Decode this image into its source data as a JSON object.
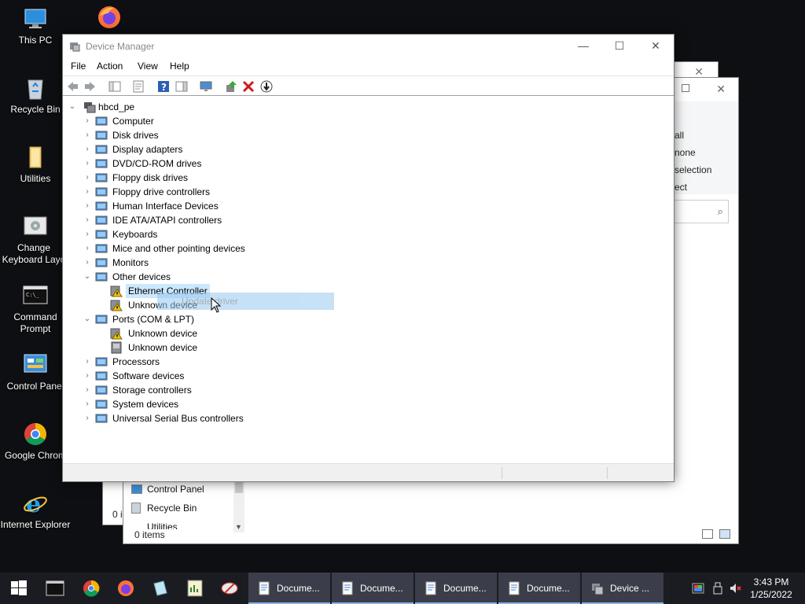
{
  "desktop": {
    "icons": [
      {
        "label": "This PC",
        "icon": "this-pc-icon"
      },
      {
        "label": "Recycle Bin",
        "icon": "recycle-bin-icon"
      },
      {
        "label": "Utilities",
        "icon": "folder-icon"
      },
      {
        "label": "Change Keyboard Layo",
        "icon": "keyboard-settings-icon"
      },
      {
        "label": "Command Prompt",
        "icon": "command-prompt-icon"
      },
      {
        "label": "Control Panel",
        "icon": "control-panel-icon"
      },
      {
        "label": "Google Chrom",
        "icon": "chrome-icon"
      },
      {
        "label": "Internet Explorer",
        "icon": "internet-explorer-icon"
      }
    ]
  },
  "background_window": {
    "ribbon_items": [
      "all",
      "none",
      "selection",
      "ect"
    ],
    "sidebar_items": [
      "Control Panel",
      "Recycle Bin",
      "Utilities"
    ],
    "status": "0 items",
    "left_status": "0 i"
  },
  "device_manager": {
    "title": "Device Manager",
    "menu": [
      "File",
      "Action",
      "View",
      "Help"
    ],
    "root": "hbcd_pe",
    "categories": [
      {
        "label": "Computer",
        "icon": "computer-icon",
        "expanded": false
      },
      {
        "label": "Disk drives",
        "icon": "disk-drive-icon",
        "expanded": false
      },
      {
        "label": "Display adapters",
        "icon": "display-adapter-icon",
        "expanded": false
      },
      {
        "label": "DVD/CD-ROM drives",
        "icon": "dvd-drive-icon",
        "expanded": false
      },
      {
        "label": "Floppy disk drives",
        "icon": "floppy-drive-icon",
        "expanded": false
      },
      {
        "label": "Floppy drive controllers",
        "icon": "controller-icon",
        "expanded": false
      },
      {
        "label": "Human Interface Devices",
        "icon": "hid-icon",
        "expanded": false
      },
      {
        "label": "IDE ATA/ATAPI controllers",
        "icon": "controller-icon",
        "expanded": false
      },
      {
        "label": "Keyboards",
        "icon": "keyboard-icon",
        "expanded": false
      },
      {
        "label": "Mice and other pointing devices",
        "icon": "mouse-icon",
        "expanded": false
      },
      {
        "label": "Monitors",
        "icon": "monitor-icon",
        "expanded": false
      },
      {
        "label": "Other devices",
        "icon": "unknown-device-icon",
        "expanded": true
      },
      {
        "label": "Ports (COM & LPT)",
        "icon": "port-icon",
        "expanded": true
      },
      {
        "label": "Processors",
        "icon": "processor-icon",
        "expanded": false
      },
      {
        "label": "Software devices",
        "icon": "software-device-icon",
        "expanded": false
      },
      {
        "label": "Storage controllers",
        "icon": "storage-controller-icon",
        "expanded": false
      },
      {
        "label": "System devices",
        "icon": "system-device-icon",
        "expanded": false
      },
      {
        "label": "Universal Serial Bus controllers",
        "icon": "usb-icon",
        "expanded": false
      }
    ],
    "other_devices_children": [
      {
        "label": "Ethernet Controller",
        "warning": true,
        "selected": true
      },
      {
        "label": "Unknown device",
        "warning": true,
        "selected": false
      }
    ],
    "ports_children": [
      {
        "label": "Unknown device",
        "warning": true
      },
      {
        "label": "Unknown device",
        "warning": false
      }
    ],
    "context_menu_ghost": "Update driver"
  },
  "taskbar": {
    "tasks": [
      {
        "label": "Docume...",
        "icon": "document-icon"
      },
      {
        "label": "Docume...",
        "icon": "document-icon"
      },
      {
        "label": "Docume...",
        "icon": "document-icon"
      },
      {
        "label": "Docume...",
        "icon": "document-icon"
      },
      {
        "label": "Device ...",
        "icon": "device-manager-icon"
      }
    ],
    "time": "3:43 PM",
    "date": "1/25/2022"
  }
}
